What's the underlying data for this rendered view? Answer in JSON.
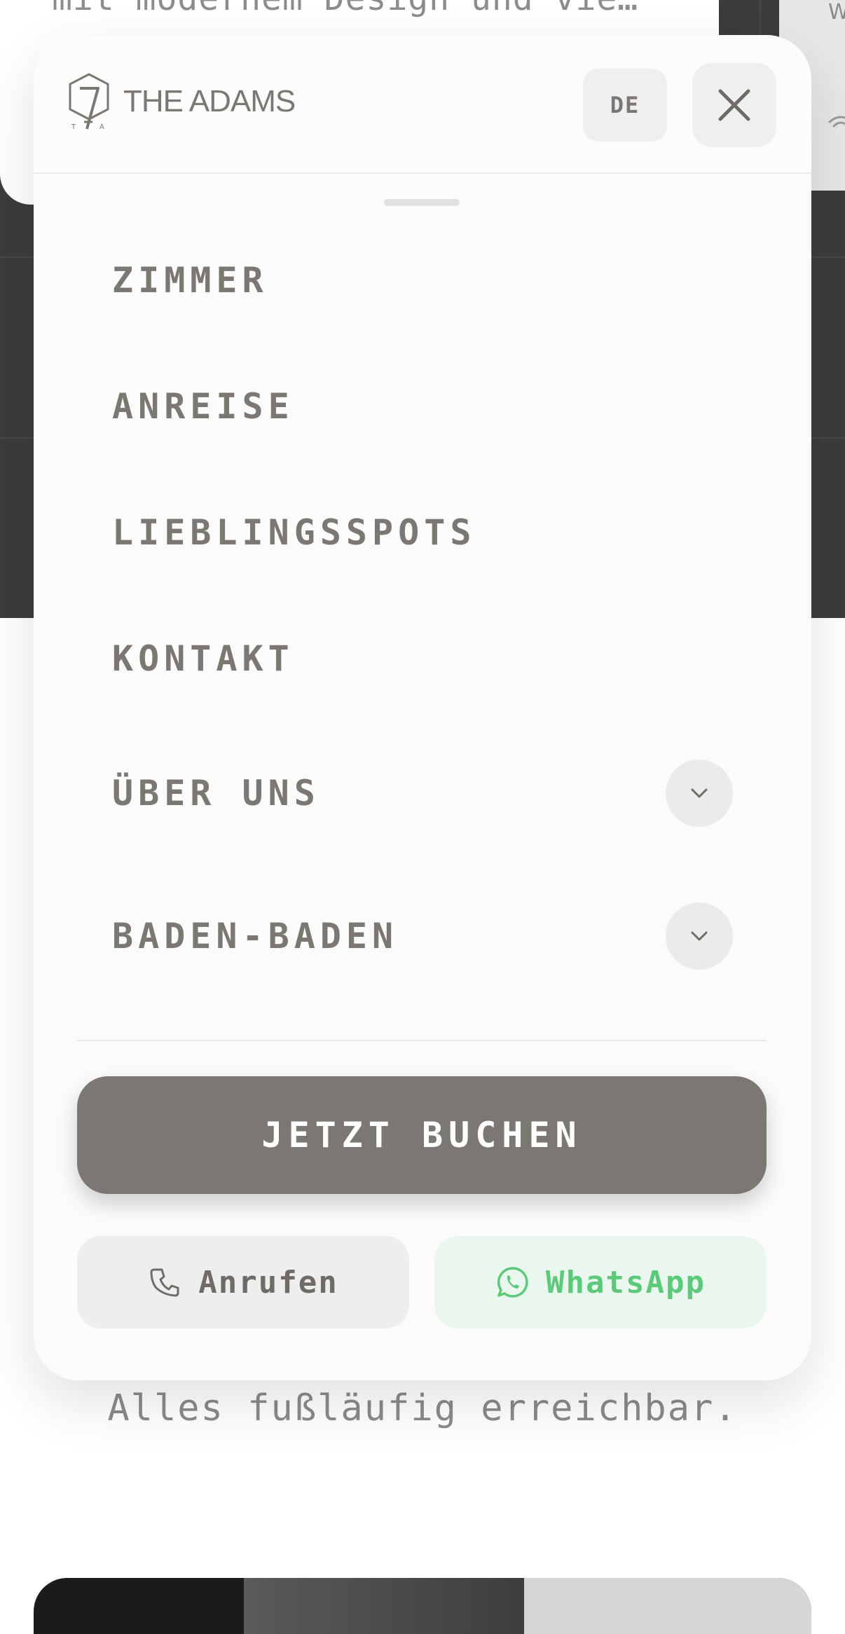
{
  "background": {
    "intro_text": "mit modernem Design und vie…",
    "tile_letter": "W",
    "footer_text": "Alles fußläufig erreichbar."
  },
  "header": {
    "logo_text": "THE ADAMS",
    "language_label": "DE"
  },
  "menu": {
    "items": [
      {
        "label": "ZIMMER"
      },
      {
        "label": "ANREISE"
      },
      {
        "label": "LIEBLINGSSPOTS"
      },
      {
        "label": "KONTAKT"
      },
      {
        "label": "ÜBER UNS"
      },
      {
        "label": "BADEN-BADEN"
      }
    ]
  },
  "actions": {
    "book_label": "JETZT BUCHEN",
    "call_label": "Anrufen",
    "whatsapp_label": "WhatsApp"
  },
  "colors": {
    "brand": "#7b7772",
    "whatsapp_green": "#5cc97b",
    "whatsapp_bg": "#eaf7ee",
    "panel_bg": "#fbfbfb"
  },
  "icons": {
    "close": "close-icon",
    "expand": "chevron-down-icon",
    "call": "phone-icon",
    "whatsapp": "whatsapp-icon",
    "logo": "logo-mark-icon"
  }
}
